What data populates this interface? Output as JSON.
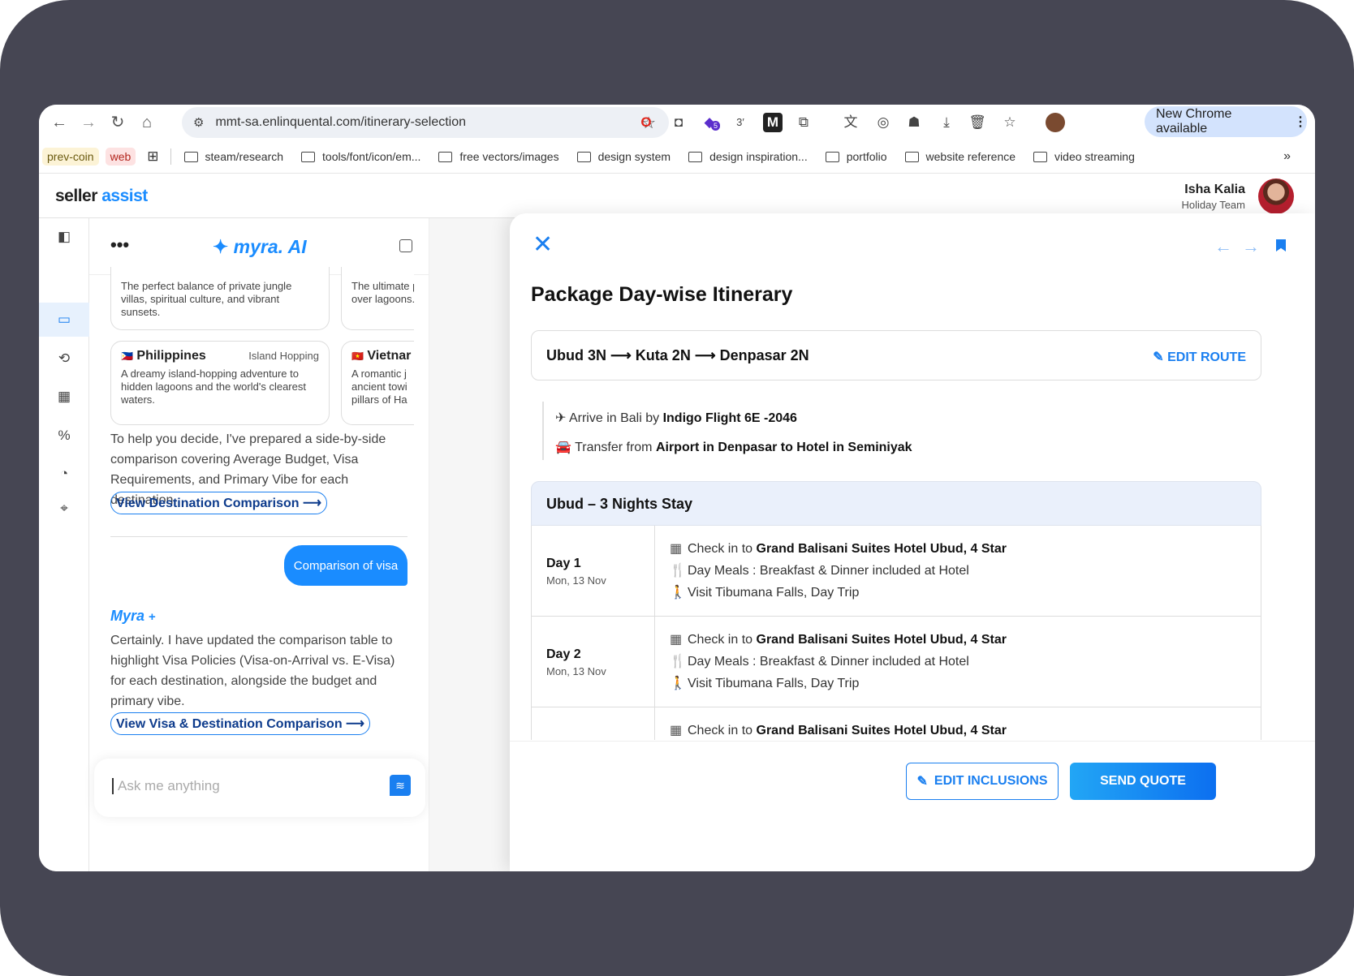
{
  "browser": {
    "url": "mmt-sa.enlinquental.com/itinerary-selection",
    "new_chrome": "New Chrome available",
    "ext_counter": "3′",
    "ext_badge": "5",
    "bookmarks": {
      "chips": [
        "prev-coin",
        "web"
      ],
      "folders": [
        "steam/research",
        "tools/font/icon/em...",
        "free vectors/images",
        "design system",
        "design inspiration...",
        "portfolio",
        "website reference",
        "video streaming"
      ]
    }
  },
  "app": {
    "logo_a": "seller",
    "logo_b": "assist",
    "user_name": "Isha Kalia",
    "user_team": "Holiday Team"
  },
  "chat": {
    "title": "myra. AI",
    "cards_top": [
      {
        "desc": "The perfect balance of private jungle villas, spiritual culture, and vibrant sunsets."
      },
      {
        "desc": "The ultimate private over lagoons."
      }
    ],
    "cards": [
      {
        "flag": "🇵🇭",
        "country": "Philippines",
        "tag": "Island Hopping",
        "desc": "A dreamy island-hopping adventure to hidden lagoons and the world's clearest waters."
      },
      {
        "flag": "🇻🇳",
        "country": "Vietnar",
        "tag": "",
        "desc": "A romantic j ancient towi pillars of Ha"
      }
    ],
    "msg1": "To help you decide, I've prepared a side-by-side comparison covering Average Budget, Visa Requirements, and Primary Vibe for each destination.",
    "link1": "View Destination Comparison ⟶",
    "user_msg": "Comparison of visa",
    "bot_name": "Myra",
    "msg2": "Certainly. I have updated the comparison table to highlight Visa Policies (Visa-on-Arrival vs. E-Visa) for each destination, alongside the budget and primary vibe.",
    "link2": "View Visa & Destination Comparison ⟶",
    "placeholder": "Ask me anything"
  },
  "drawer": {
    "title": "Package Day-wise Itinerary",
    "route": "Ubud 3N ⟶ Kuta 2N ⟶ Denpasar 2N",
    "edit_route": "EDIT ROUTE",
    "arrive_pre": "Arrive in Bali by",
    "arrive_bold": "Indigo Flight 6E -2046",
    "transfer_pre": "Transfer from",
    "transfer_bold": "Airport in Denpasar to Hotel in Seminiyak",
    "stay": "Ubud – 3 Nights Stay",
    "days": [
      {
        "day": "Day 1",
        "date": "Mon, 13 Nov",
        "checkin_pre": "Check in to",
        "hotel": "Grand Balisani Suites Hotel Ubud, 4 Star",
        "meals": "Day Meals : Breakfast & Dinner included at Hotel",
        "visit": "Visit Tibumana Falls, Day Trip"
      },
      {
        "day": "Day 2",
        "date": "Mon, 13 Nov",
        "checkin_pre": "Check in to",
        "hotel": "Grand Balisani Suites Hotel Ubud, 4 Star",
        "meals": "Day Meals : Breakfast & Dinner included at Hotel",
        "visit": "Visit Tibumana Falls, Day Trip"
      },
      {
        "day": "",
        "date": "",
        "checkin_pre": "Check in to",
        "hotel": "Grand Balisani Suites Hotel Ubud, 4 Star",
        "meals": "",
        "visit": ""
      }
    ],
    "edit_inclusions": "EDIT INCLUSIONS",
    "send_quote": "SEND QUOTE"
  }
}
